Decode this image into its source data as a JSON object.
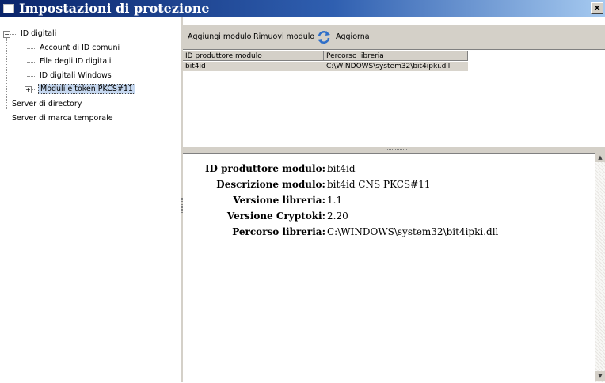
{
  "window": {
    "title": "Impostazioni di protezione",
    "close_label": "x"
  },
  "tree": {
    "root": {
      "label": "ID digitali",
      "expander": "−"
    },
    "children": [
      {
        "label": "Account di ID comuni"
      },
      {
        "label": "File degli ID digitali"
      },
      {
        "label": "ID digitali Windows"
      },
      {
        "label": "Moduli e token PKCS#11",
        "expander": "+",
        "selected": true
      }
    ],
    "others": [
      {
        "label": "Server di directory"
      },
      {
        "label": "Server di marca temporale"
      }
    ]
  },
  "toolbar": {
    "add_label": "Aggiungi modulo",
    "remove_label": "Rimuovi modulo",
    "refresh_label": "Aggiorna",
    "refresh_icon": "refresh-icon"
  },
  "grid": {
    "columns": [
      "ID produttore modulo",
      "Percorso libreria"
    ],
    "rows": [
      {
        "id": "bit4id",
        "path": "C:\\WINDOWS\\system32\\bit4ipki.dll"
      }
    ]
  },
  "details": [
    {
      "label": "ID produttore modulo:",
      "value": "bit4id"
    },
    {
      "label": "Descrizione modulo:",
      "value": "bit4id CNS PKCS#11"
    },
    {
      "label": "Versione libreria:",
      "value": "1.1"
    },
    {
      "label": "Versione Cryptoki:",
      "value": "2.20"
    },
    {
      "label": "Percorso libreria:",
      "value": "C:\\WINDOWS\\system32\\bit4ipki.dll"
    }
  ],
  "colors": {
    "title_bar": "#0a246a",
    "selection": "#c6d8f0",
    "toolbar": "#d4d0c8"
  }
}
